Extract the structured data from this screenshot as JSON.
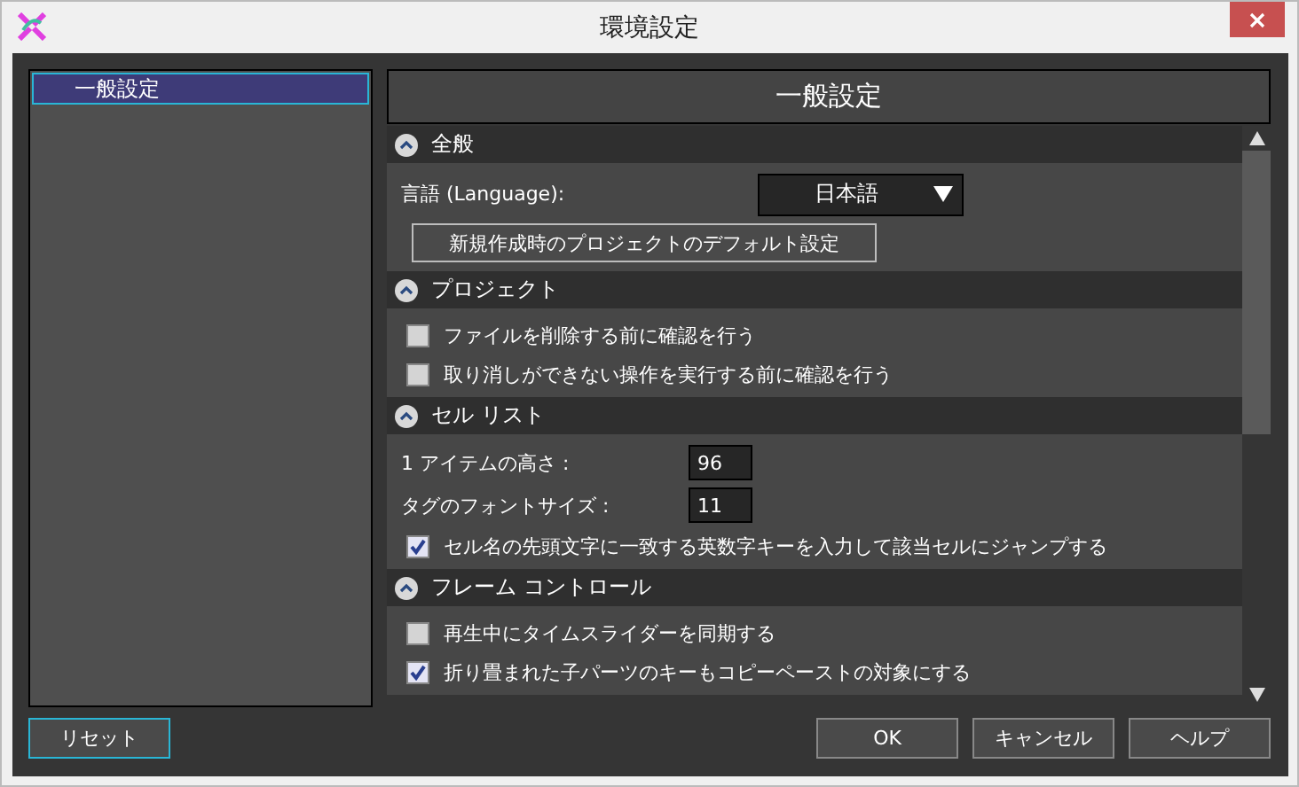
{
  "window": {
    "title": "環境設定"
  },
  "sidebar": {
    "items": [
      {
        "label": "一般設定",
        "selected": true
      }
    ]
  },
  "panel": {
    "title": "一般設定"
  },
  "sections": [
    {
      "title": "全般",
      "expanded": true,
      "items": [
        {
          "kind": "dropdown",
          "label": "言語 (Language):",
          "value": "日本語"
        },
        {
          "kind": "button",
          "label": "新規作成時のプロジェクトのデフォルト設定"
        }
      ]
    },
    {
      "title": "プロジェクト",
      "expanded": true,
      "items": [
        {
          "kind": "checkbox",
          "label": "ファイルを削除する前に確認を行う",
          "checked": false
        },
        {
          "kind": "checkbox",
          "label": "取り消しができない操作を実行する前に確認を行う",
          "checked": false
        }
      ]
    },
    {
      "title": "セル リスト",
      "expanded": true,
      "items": [
        {
          "kind": "number",
          "label": "1 アイテムの高さ :",
          "value": "96"
        },
        {
          "kind": "number",
          "label": "タグのフォントサイズ :",
          "value": "11"
        },
        {
          "kind": "checkbox",
          "label": "セル名の先頭文字に一致する英数字キーを入力して該当セルにジャンプする",
          "checked": true
        }
      ]
    },
    {
      "title": "フレーム コントロール",
      "expanded": true,
      "items": [
        {
          "kind": "checkbox",
          "label": "再生中にタイムスライダーを同期する",
          "checked": false
        },
        {
          "kind": "checkbox",
          "label": "折り畳まれた子パーツのキーもコピーペーストの対象にする",
          "checked": true
        }
      ]
    }
  ],
  "buttons": {
    "reset": "リセット",
    "actions": [
      "OK",
      "キャンセル",
      "ヘルプ"
    ]
  }
}
